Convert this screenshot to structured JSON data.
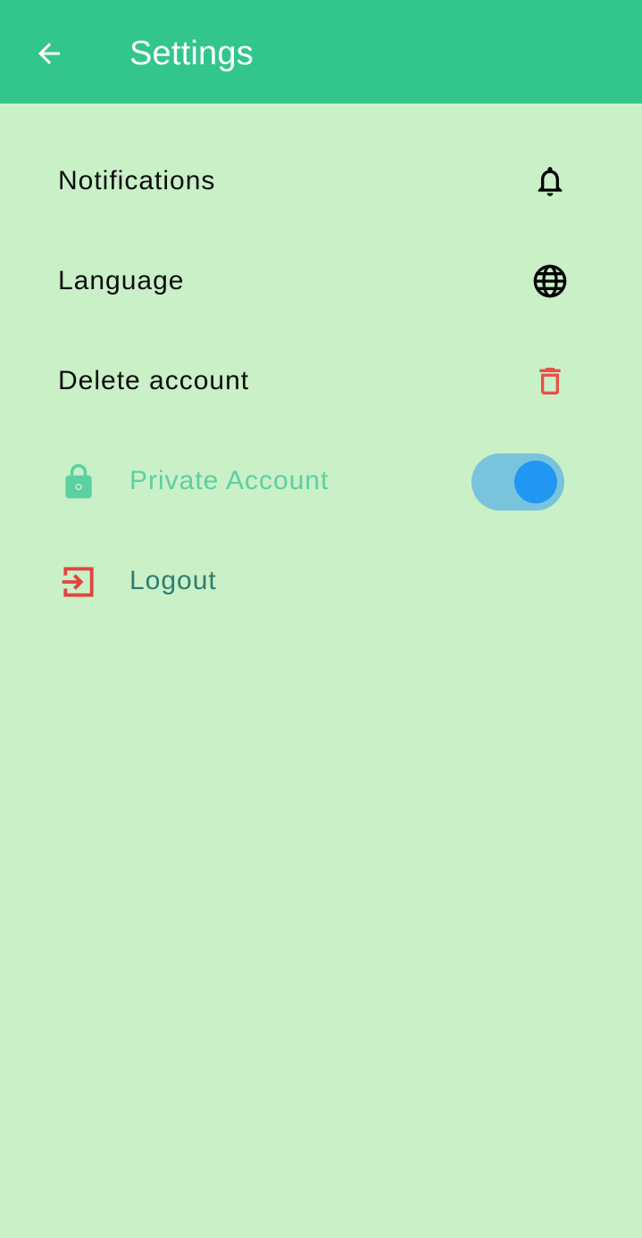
{
  "appbar": {
    "title": "Settings",
    "back_icon": "arrow-back-icon",
    "color": "#33c68c"
  },
  "settings": {
    "notifications": {
      "label": "Notifications",
      "icon": "bell-icon"
    },
    "language": {
      "label": "Language",
      "icon": "globe-icon"
    },
    "delete_account": {
      "label": "Delete account",
      "icon": "trash-icon",
      "icon_color": "#e8504b"
    },
    "private_account": {
      "label": "Private Account",
      "icon": "lock-icon",
      "color": "#5cd0a0",
      "toggle_on": true,
      "toggle_track_color": "#79c4dc",
      "toggle_thumb_color": "#2196f3"
    },
    "logout": {
      "label": "Logout",
      "icon": "logout-icon",
      "icon_color": "#e0463f",
      "label_color": "#2e7d72"
    }
  },
  "background": "#c9f0c7"
}
